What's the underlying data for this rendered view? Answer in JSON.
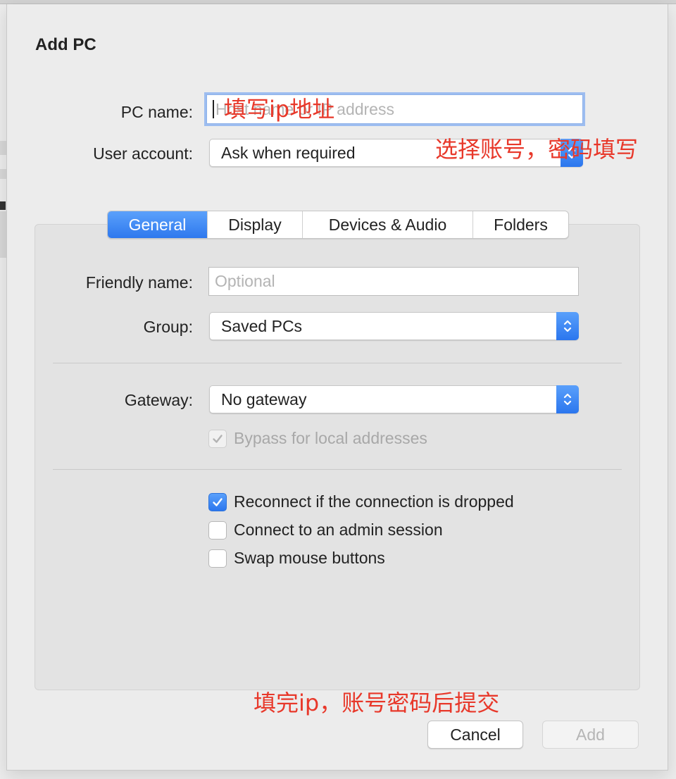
{
  "dialog": {
    "title": "Add PC",
    "pc_name": {
      "label": "PC name:",
      "value": "",
      "placeholder": "Host name or IP address"
    },
    "user_account": {
      "label": "User account:",
      "value": "Ask when required"
    }
  },
  "tabs": [
    {
      "label": "General",
      "active": true
    },
    {
      "label": "Display",
      "active": false
    },
    {
      "label": "Devices & Audio",
      "active": false
    },
    {
      "label": "Folders",
      "active": false
    }
  ],
  "general": {
    "friendly_name": {
      "label": "Friendly name:",
      "value": "",
      "placeholder": "Optional"
    },
    "group": {
      "label": "Group:",
      "value": "Saved PCs"
    },
    "gateway": {
      "label": "Gateway:",
      "value": "No gateway"
    },
    "bypass_local": {
      "label": "Bypass for local addresses",
      "checked": true,
      "disabled": true
    },
    "options": [
      {
        "label": "Reconnect if the connection is dropped",
        "checked": true
      },
      {
        "label": "Connect to an admin session",
        "checked": false
      },
      {
        "label": "Swap mouse buttons",
        "checked": false
      }
    ]
  },
  "buttons": {
    "cancel": "Cancel",
    "add": "Add"
  },
  "annotations": {
    "ip": "填写ip地址",
    "account": "选择账号，密码填写",
    "submit": "填完ip，账号密码后提交"
  },
  "background": {
    "fragment": "2"
  },
  "colors": {
    "accent": "#2e78ee",
    "annotation": "#e8382a"
  }
}
